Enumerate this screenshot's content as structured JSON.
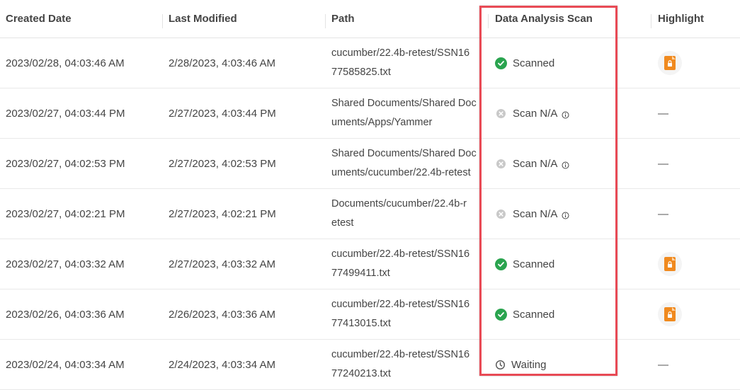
{
  "header": {
    "created": "Created Date",
    "modified": "Last Modified",
    "path": "Path",
    "scan": "Data Analysis Scan",
    "highlight": "Highlight"
  },
  "rows": [
    {
      "created": "2023/02/28, 04:03:46 AM",
      "modified": "2/28/2023, 4:03:46 AM",
      "path": "cucumber/22.4b-retest/SSN16\n77585825.txt",
      "scan": "Scanned",
      "scan_status": "scanned",
      "highlight": "lock-document-icon"
    },
    {
      "created": "2023/02/27, 04:03:44 PM",
      "modified": "2/27/2023, 4:03:44 PM",
      "path": "Shared Documents/Shared Doc\numents/Apps/Yammer",
      "scan": "Scan N/A",
      "scan_status": "na",
      "highlight": "—"
    },
    {
      "created": "2023/02/27, 04:02:53 PM",
      "modified": "2/27/2023, 4:02:53 PM",
      "path": "Shared Documents/Shared Doc\numents/cucumber/22.4b-retest",
      "scan": "Scan N/A",
      "scan_status": "na",
      "highlight": "—"
    },
    {
      "created": "2023/02/27, 04:02:21 PM",
      "modified": "2/27/2023, 4:02:21 PM",
      "path": "Documents/cucumber/22.4b-r\netest",
      "scan": "Scan N/A",
      "scan_status": "na",
      "highlight": "—"
    },
    {
      "created": "2023/02/27, 04:03:32 AM",
      "modified": "2/27/2023, 4:03:32 AM",
      "path": "cucumber/22.4b-retest/SSN16\n77499411.txt",
      "scan": "Scanned",
      "scan_status": "scanned",
      "highlight": "lock-document-icon"
    },
    {
      "created": "2023/02/26, 04:03:36 AM",
      "modified": "2/26/2023, 4:03:36 AM",
      "path": "cucumber/22.4b-retest/SSN16\n77413015.txt",
      "scan": "Scanned",
      "scan_status": "scanned",
      "highlight": "lock-document-icon"
    },
    {
      "created": "2023/02/24, 04:03:34 AM",
      "modified": "2/24/2023, 4:03:34 AM",
      "path": "cucumber/22.4b-retest/SSN16\n77240213.txt",
      "scan": "Waiting",
      "scan_status": "waiting",
      "highlight": "—"
    }
  ],
  "colors": {
    "scanned": "#2aa44f",
    "na": "#c9c9c9",
    "highlight_badge": "#f08a1f",
    "annotation_box": "#e84a55"
  }
}
